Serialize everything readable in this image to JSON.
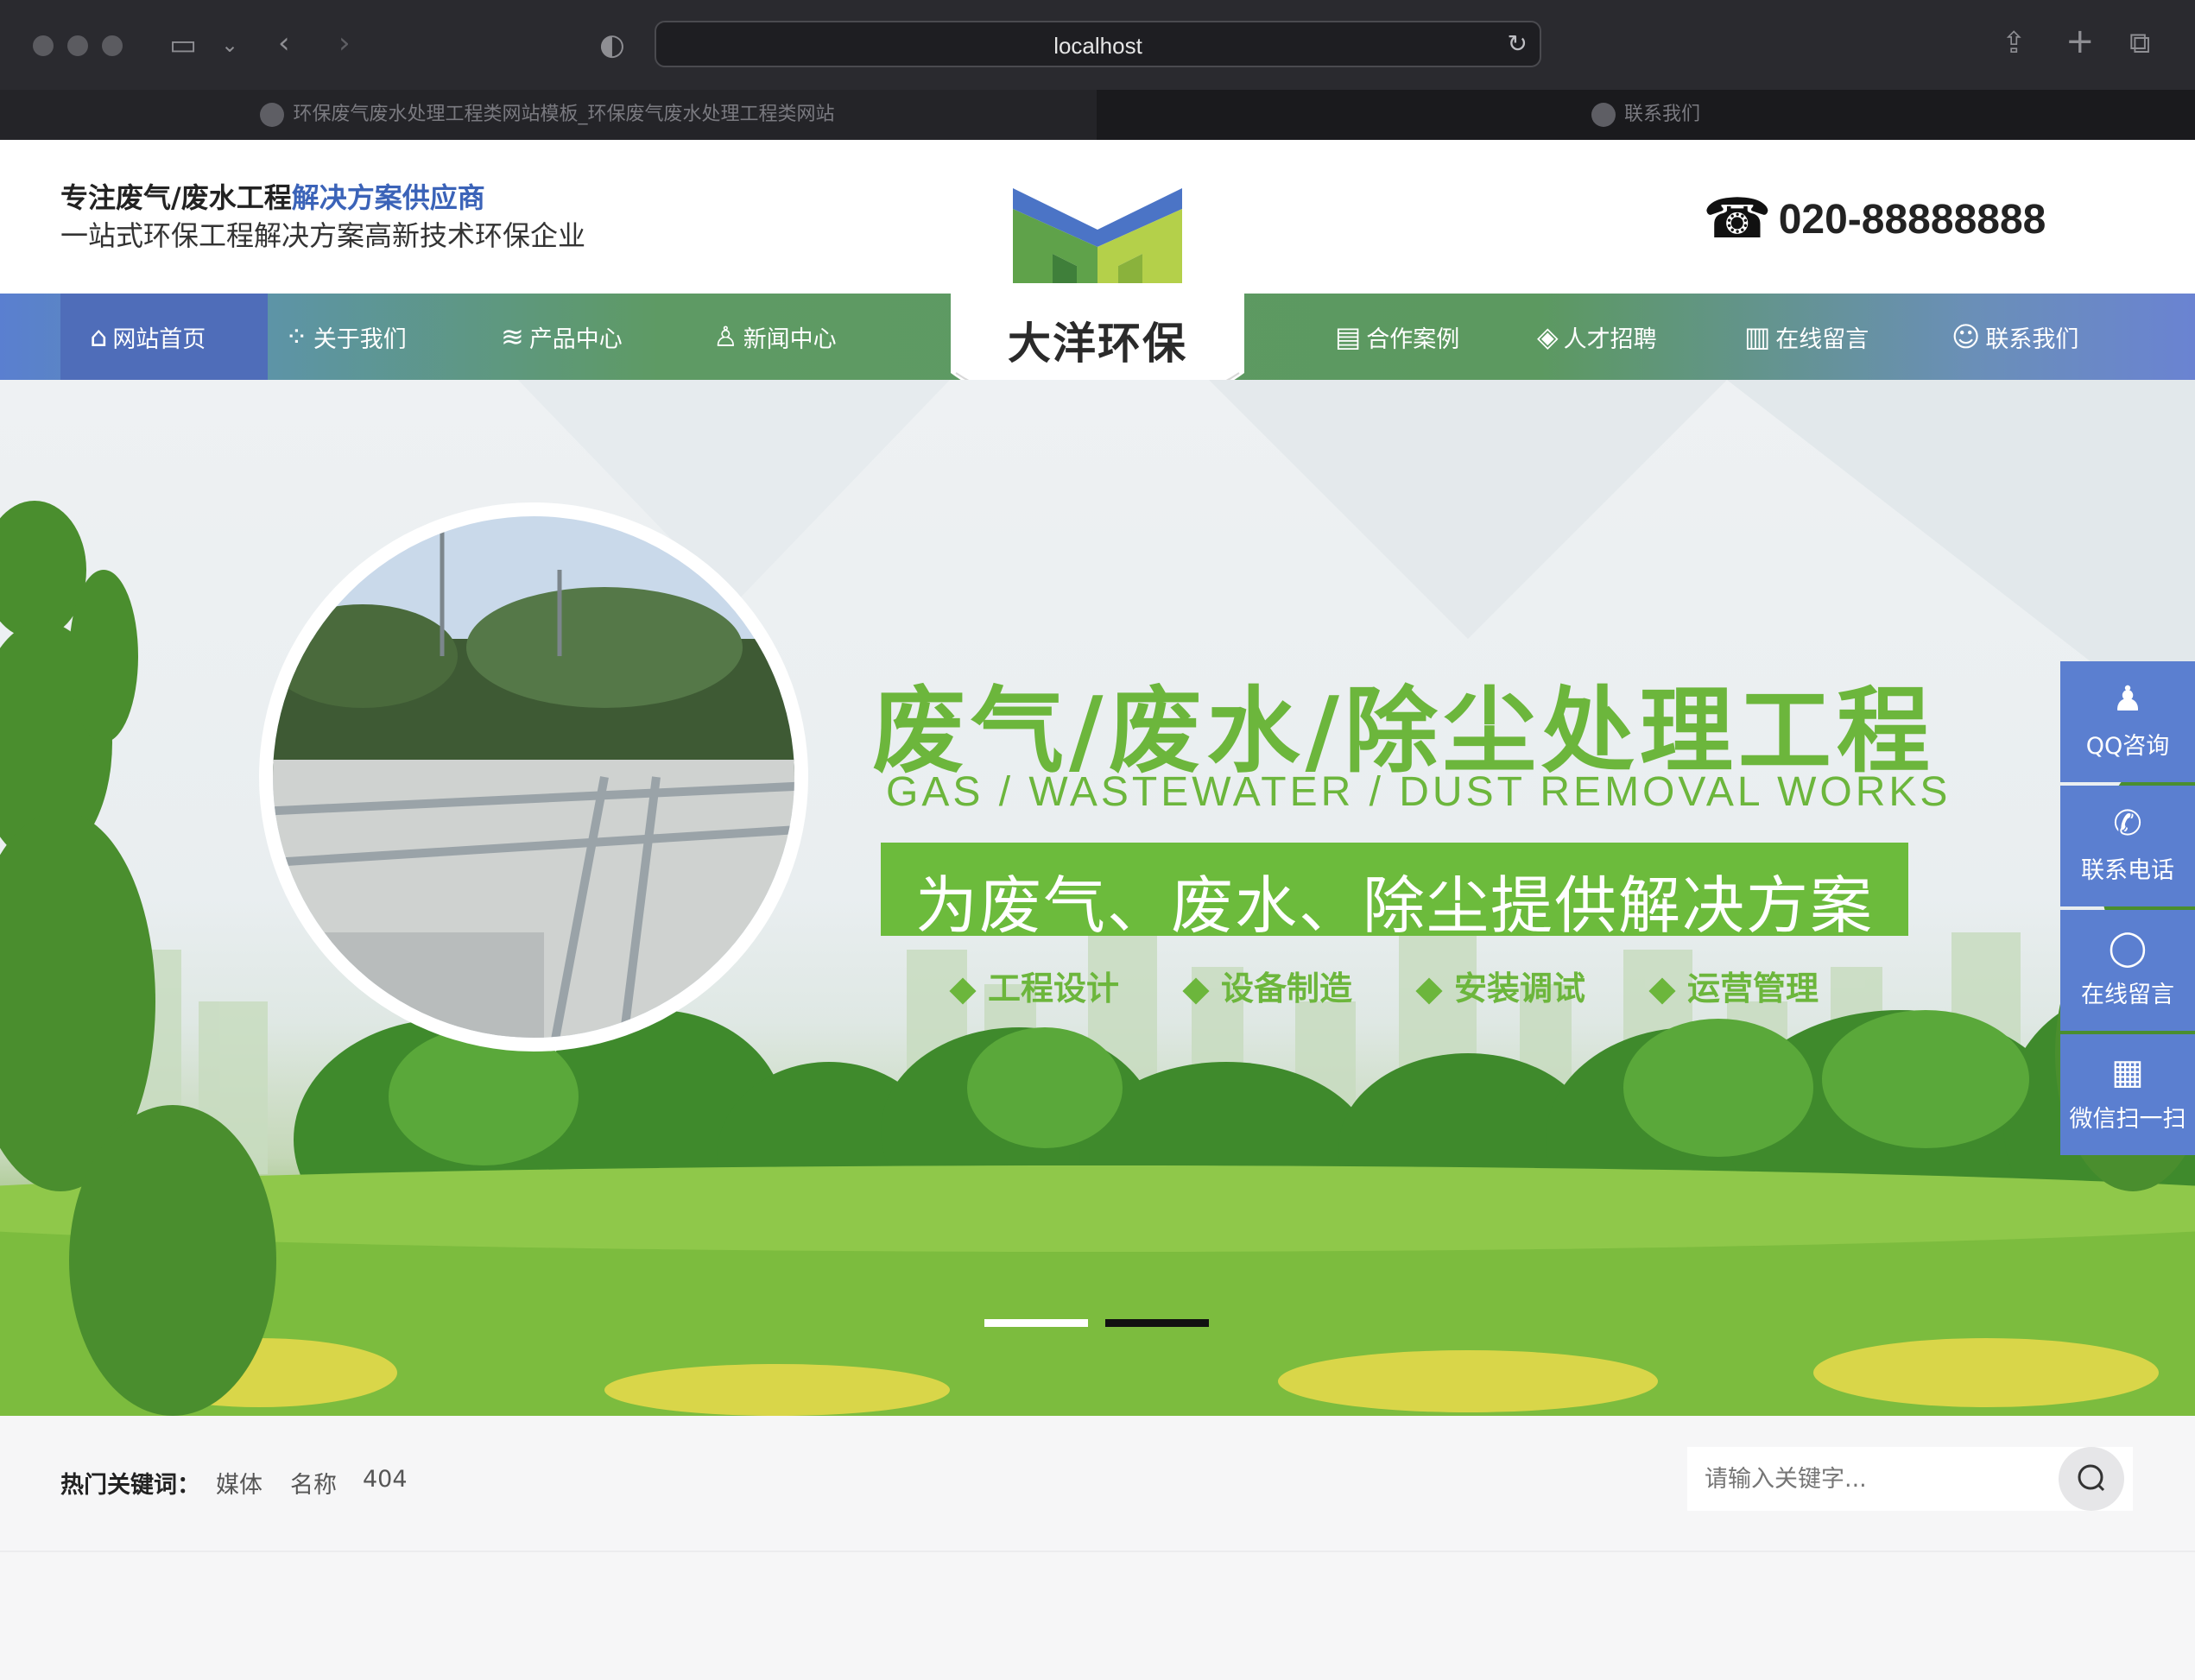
{
  "browser": {
    "url": "localhost",
    "tabs": [
      {
        "label": "环保废气废水处理工程类网站模板_环保废气废水处理工程类网站",
        "active": false
      },
      {
        "label": "联系我们",
        "active": true
      }
    ]
  },
  "header": {
    "tagline_main": "专注废气/废水工程",
    "tagline_accent": "解决方案供应商",
    "tagline_sub": "一站式环保工程解决方案高新技术环保企业",
    "phone": "020-88888888",
    "logo_text": "大洋环保"
  },
  "nav": {
    "items": [
      {
        "label": "网站首页",
        "icon": "home-icon",
        "active": true
      },
      {
        "label": "关于我们",
        "icon": "grid-icon"
      },
      {
        "label": "产品中心",
        "icon": "layers-icon"
      },
      {
        "label": "新闻中心",
        "icon": "trophy-icon"
      },
      {
        "label": "合作案例",
        "icon": "document-icon"
      },
      {
        "label": "人才招聘",
        "icon": "handshake-icon"
      },
      {
        "label": "在线留言",
        "icon": "notepad-icon"
      },
      {
        "label": "联系我们",
        "icon": "contact-icon"
      }
    ]
  },
  "banner": {
    "headline": "废气/废水/除尘处理工程",
    "subline": "GAS / WASTEWATER / DUST REMOVAL WORKS",
    "slogan": "为废气、废水、除尘提供解决方案",
    "features": [
      "工程设计",
      "设备制造",
      "安装调试",
      "运营管理"
    ],
    "slides": 2,
    "active_slide": 2
  },
  "float_bar": [
    {
      "label": "QQ咨询",
      "icon": "qq-icon"
    },
    {
      "label": "联系电话",
      "icon": "phone-icon"
    },
    {
      "label": "在线留言",
      "icon": "chat-icon"
    },
    {
      "label": "微信扫一扫",
      "icon": "qrcode-icon"
    }
  ],
  "keywords": {
    "label": "热门关键词：",
    "items": [
      "媒体",
      "名称",
      "404"
    ]
  },
  "search": {
    "placeholder": "请输入关键字..."
  },
  "colors": {
    "brand_green": "#6cb63c",
    "brand_blue": "#5b7fd0",
    "tagline_accent": "#3b63b8"
  }
}
